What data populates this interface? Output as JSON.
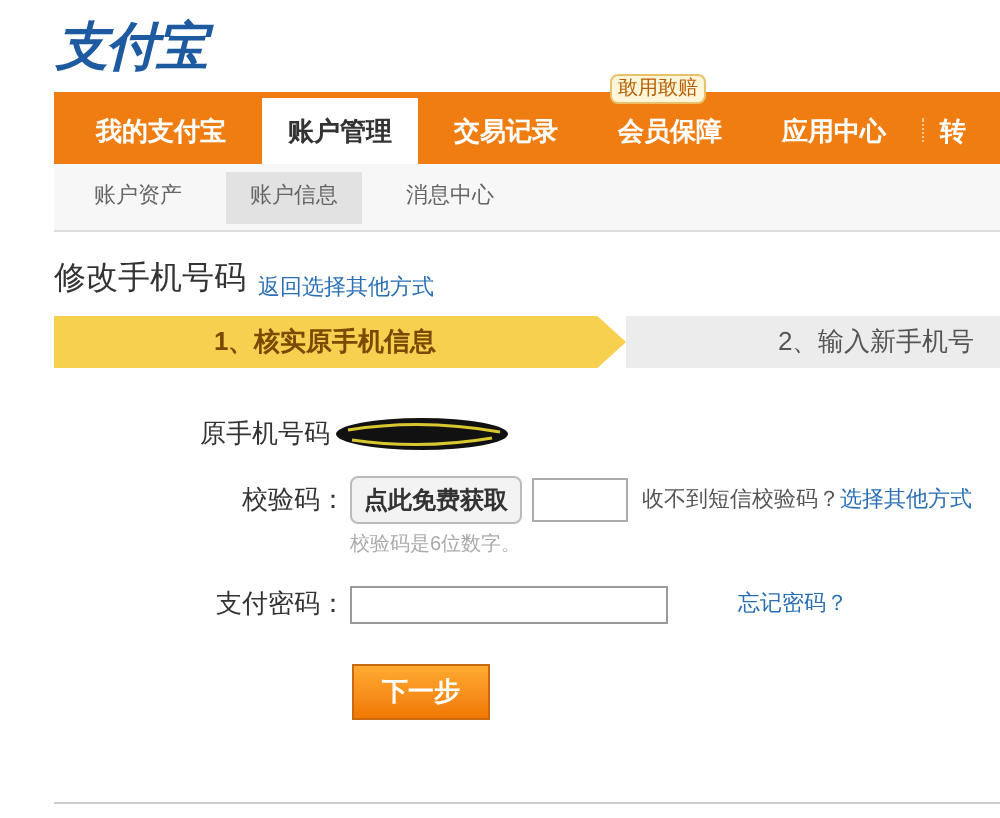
{
  "logo": {
    "text": "支付宝"
  },
  "nav": {
    "tabs": [
      {
        "label": "我的支付宝",
        "selected": false
      },
      {
        "label": "账户管理",
        "selected": true
      },
      {
        "label": "交易记录",
        "selected": false
      },
      {
        "label": "会员保障",
        "selected": false,
        "badge": "敢用敢赔"
      },
      {
        "label": "应用中心",
        "selected": false
      },
      {
        "label": "转",
        "selected": false
      }
    ]
  },
  "subnav": [
    {
      "label": "账户资产",
      "selected": false
    },
    {
      "label": "账户信息",
      "selected": true
    },
    {
      "label": "消息中心",
      "selected": false
    }
  ],
  "page": {
    "title": "修改手机号码",
    "back_link": "返回选择其他方式"
  },
  "steps": [
    {
      "label": "1、核实原手机信息",
      "selected": true
    },
    {
      "label": "2、输入新手机号",
      "selected": false
    }
  ],
  "form": {
    "phone_label": "原手机号码",
    "code_label": "校验码：",
    "code_button": "点此免费获取",
    "code_help": "收不到短信校验码？",
    "code_link": "选择其他方式",
    "code_hint": "校验码是6位数字。",
    "password_label": "支付密码：",
    "forgot_link": "忘记密码？",
    "submit": "下一步"
  }
}
